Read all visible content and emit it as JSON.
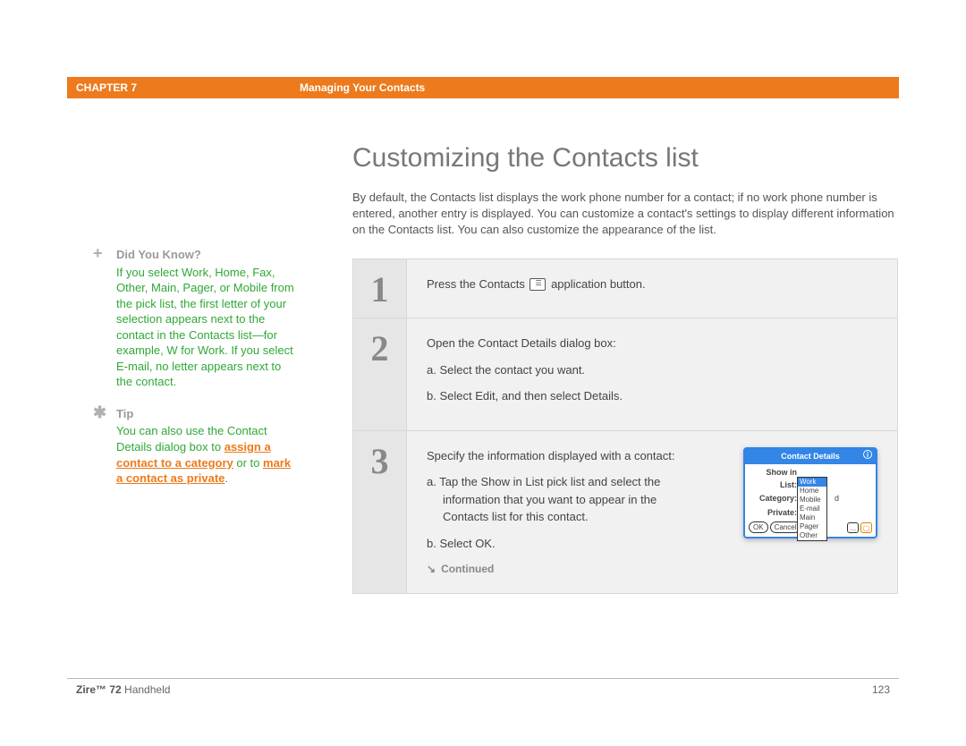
{
  "header": {
    "chapter": "CHAPTER 7",
    "section": "Managing Your Contacts"
  },
  "title": "Customizing the Contacts list",
  "intro": "By default, the Contacts list displays the work phone number for a contact; if no work phone number is entered, another entry is displayed. You can customize a contact's settings to display different information on the Contacts list. You can also customize the appearance of the list.",
  "sidebar": {
    "dyk_title": "Did You Know?",
    "dyk_text": "If you select Work, Home, Fax, Other, Main, Pager, or Mobile from the pick list, the first letter of your selection appears next to the contact in the Contacts list—for example, W for Work. If you select E-mail, no letter appears next to the contact.",
    "tip_title": "Tip",
    "tip_prefix": "You can also use the Contact Details dialog box to ",
    "tip_link1": "assign a contact to a category",
    "tip_mid": " or to ",
    "tip_link2": "mark a contact as private",
    "tip_end": "."
  },
  "steps": {
    "s1_num": "1",
    "s1_pre": "Press the Contacts ",
    "s1_post": " application button.",
    "s2_num": "2",
    "s2_intro": "Open the Contact Details dialog box:",
    "s2_a": "a.  Select the contact you want.",
    "s2_b": "b.  Select Edit, and then select Details.",
    "s3_num": "3",
    "s3_intro": "Specify the information displayed with a contact:",
    "s3_a": "a.  Tap the Show in List pick list and select the information that you want to appear in the Contacts list for this contact.",
    "s3_b": "b.  Select OK.",
    "continued": "Continued"
  },
  "screenshot": {
    "title": "Contact Details",
    "row1_label": "Show in List:",
    "row2_label": "Category:",
    "row2_val": "d",
    "row3_label": "Private:",
    "btn_ok": "OK",
    "btn_cancel": "Cancel",
    "opts": {
      "o0": "Work",
      "o1": "Home",
      "o2": "Mobile",
      "o3": "E-mail",
      "o4": "Main",
      "o5": "Pager",
      "o6": "Other"
    }
  },
  "footer": {
    "product_bold": "Zire™ 72",
    "product_rest": " Handheld",
    "page": "123"
  }
}
